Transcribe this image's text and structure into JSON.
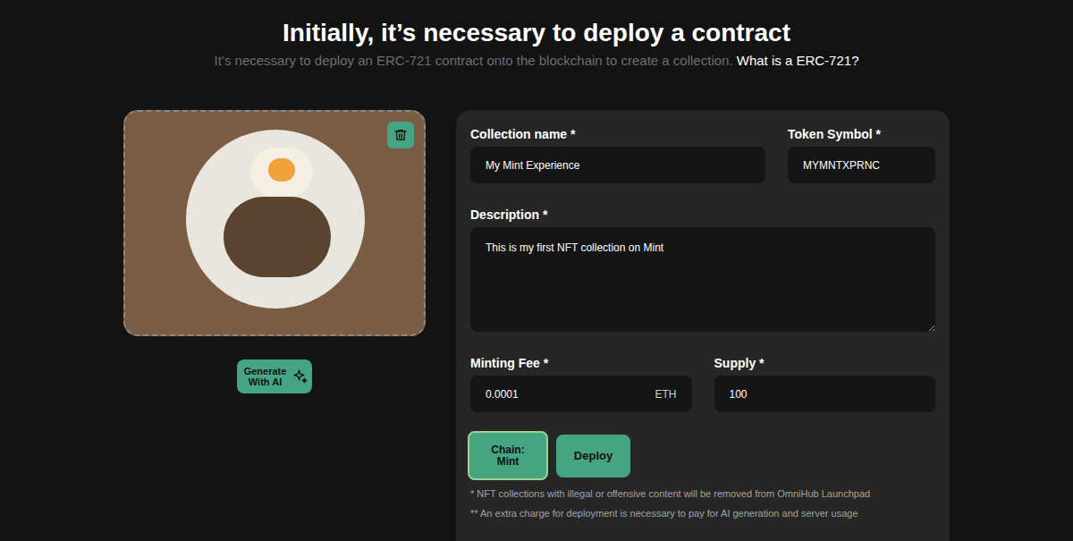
{
  "header": {
    "title": "Initially, it’s necessary to deploy a contract",
    "subtitle": "It’s necessary to deploy an ERC-721 contract onto the blockchain to create a collection.",
    "help_link": "What is a ERC-721?"
  },
  "generate_button": {
    "label": "Generate With AI"
  },
  "form": {
    "collection_name": {
      "label": "Collection name *",
      "value": "My Mint Experience"
    },
    "token_symbol": {
      "label": "Token Symbol *",
      "value": "MYMNTXPRNC"
    },
    "description": {
      "label": "Description *",
      "value": "This is my first NFT collection on Mint"
    },
    "minting_fee": {
      "label": "Minting Fee *",
      "value": "0.0001",
      "unit": "ETH"
    },
    "supply": {
      "label": "Supply *",
      "value": "100"
    }
  },
  "buttons": [
    {
      "label": "Chain: Mint",
      "selected": true
    },
    {
      "label": "Deploy",
      "selected": false
    }
  ],
  "notes": [
    "* NFT collections with illegal or offensive content will be removed from OmniHub Launchpad",
    "** An extra charge for deployment is necessary to pay for AI generation and server usage"
  ]
}
